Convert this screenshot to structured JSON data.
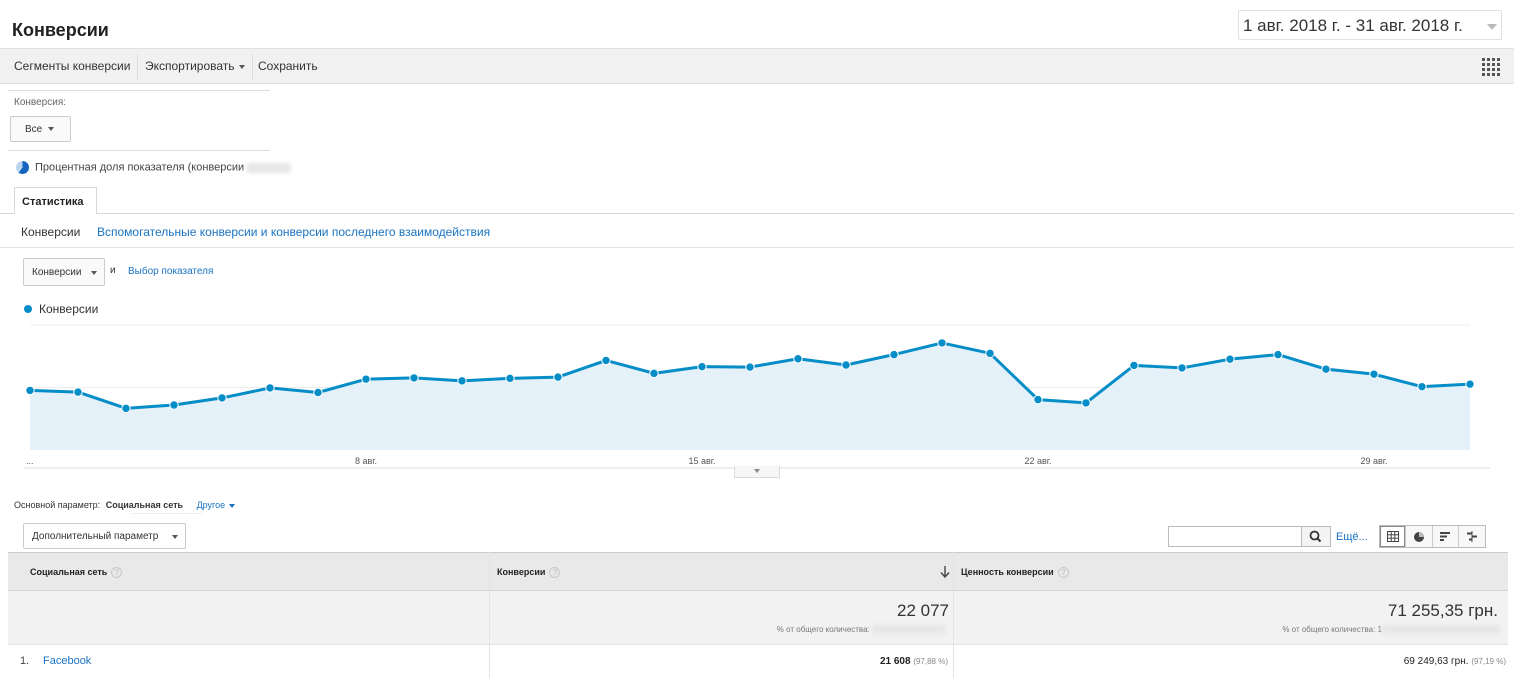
{
  "header": {
    "title": "Конверсии",
    "date_range": "1 авг. 2018 г. - 31 авг. 2018 г."
  },
  "toolbar": {
    "segments_label": "Сегменты конверсии",
    "export_label": "Экспортировать",
    "save_label": "Сохранить",
    "grid_icon": "apps-grid-icon"
  },
  "filters": {
    "conversion_label": "Конверсия:",
    "conversion_value": "Все",
    "share_text": "Процентная доля показателя (конверсии"
  },
  "tabs": {
    "stat_label": "Статистика",
    "sub": [
      {
        "label": "Конверсии"
      },
      {
        "label": "Вспомогательные конверсии и конверсии последнего взаимодействия"
      }
    ]
  },
  "metric": {
    "select_label": "Конверсии",
    "and_text": "и",
    "choose_label": "Выбор показателя"
  },
  "chart_data": {
    "type": "area",
    "series": [
      {
        "name": "Конверсии",
        "color": "#058dc7",
        "values": [
          715,
          695,
          500,
          540,
          625,
          745,
          690,
          850,
          865,
          830,
          860,
          875,
          1075,
          920,
          1000,
          995,
          1095,
          1020,
          1145,
          1285,
          1160,
          605,
          565,
          1015,
          985,
          1090,
          1145,
          970,
          910,
          760,
          790
        ]
      }
    ],
    "x": [
      "1 авг.",
      "2 авг.",
      "3 авг.",
      "4 авг.",
      "5 авг.",
      "6 авг.",
      "7 авг.",
      "8 авг.",
      "9 авг.",
      "10 авг.",
      "11 авг.",
      "12 авг.",
      "13 авг.",
      "14 авг.",
      "15 авг.",
      "16 авг.",
      "17 авг.",
      "18 авг.",
      "19 авг.",
      "20 авг.",
      "21 авг.",
      "22 авг.",
      "23 авг.",
      "24 авг.",
      "25 авг.",
      "26 авг.",
      "27 авг.",
      "28 авг.",
      "29 авг.",
      "30 авг.",
      "31 авг."
    ],
    "x_tick_labels": [
      "...",
      "8 авг.",
      "15 авг.",
      "22 авг.",
      "29 авг."
    ],
    "ylim": [
      0,
      1500
    ],
    "grid": true
  },
  "table": {
    "primary_label": "Основной параметр:",
    "primary_value": "Социальная сеть",
    "other_label": "Другое",
    "secondary_label": "Дополнительный параметр",
    "more_label": "Ещё...",
    "columns": [
      {
        "label": "Социальная сеть"
      },
      {
        "label": "Конверсии"
      },
      {
        "label": "Ценность конверсии"
      }
    ],
    "totals": {
      "conversions": "22 077",
      "conversions_sub": "% от общего количества:",
      "value": "71 255,35 грн.",
      "value_sub": "% от общего количества: 1"
    },
    "rows": [
      {
        "num": "1.",
        "name": "Facebook",
        "conversions": "21 608",
        "conversions_pct": "(97,88 %)",
        "value": "69 249,63 грн.",
        "value_pct": "(97,19 %)"
      }
    ]
  }
}
